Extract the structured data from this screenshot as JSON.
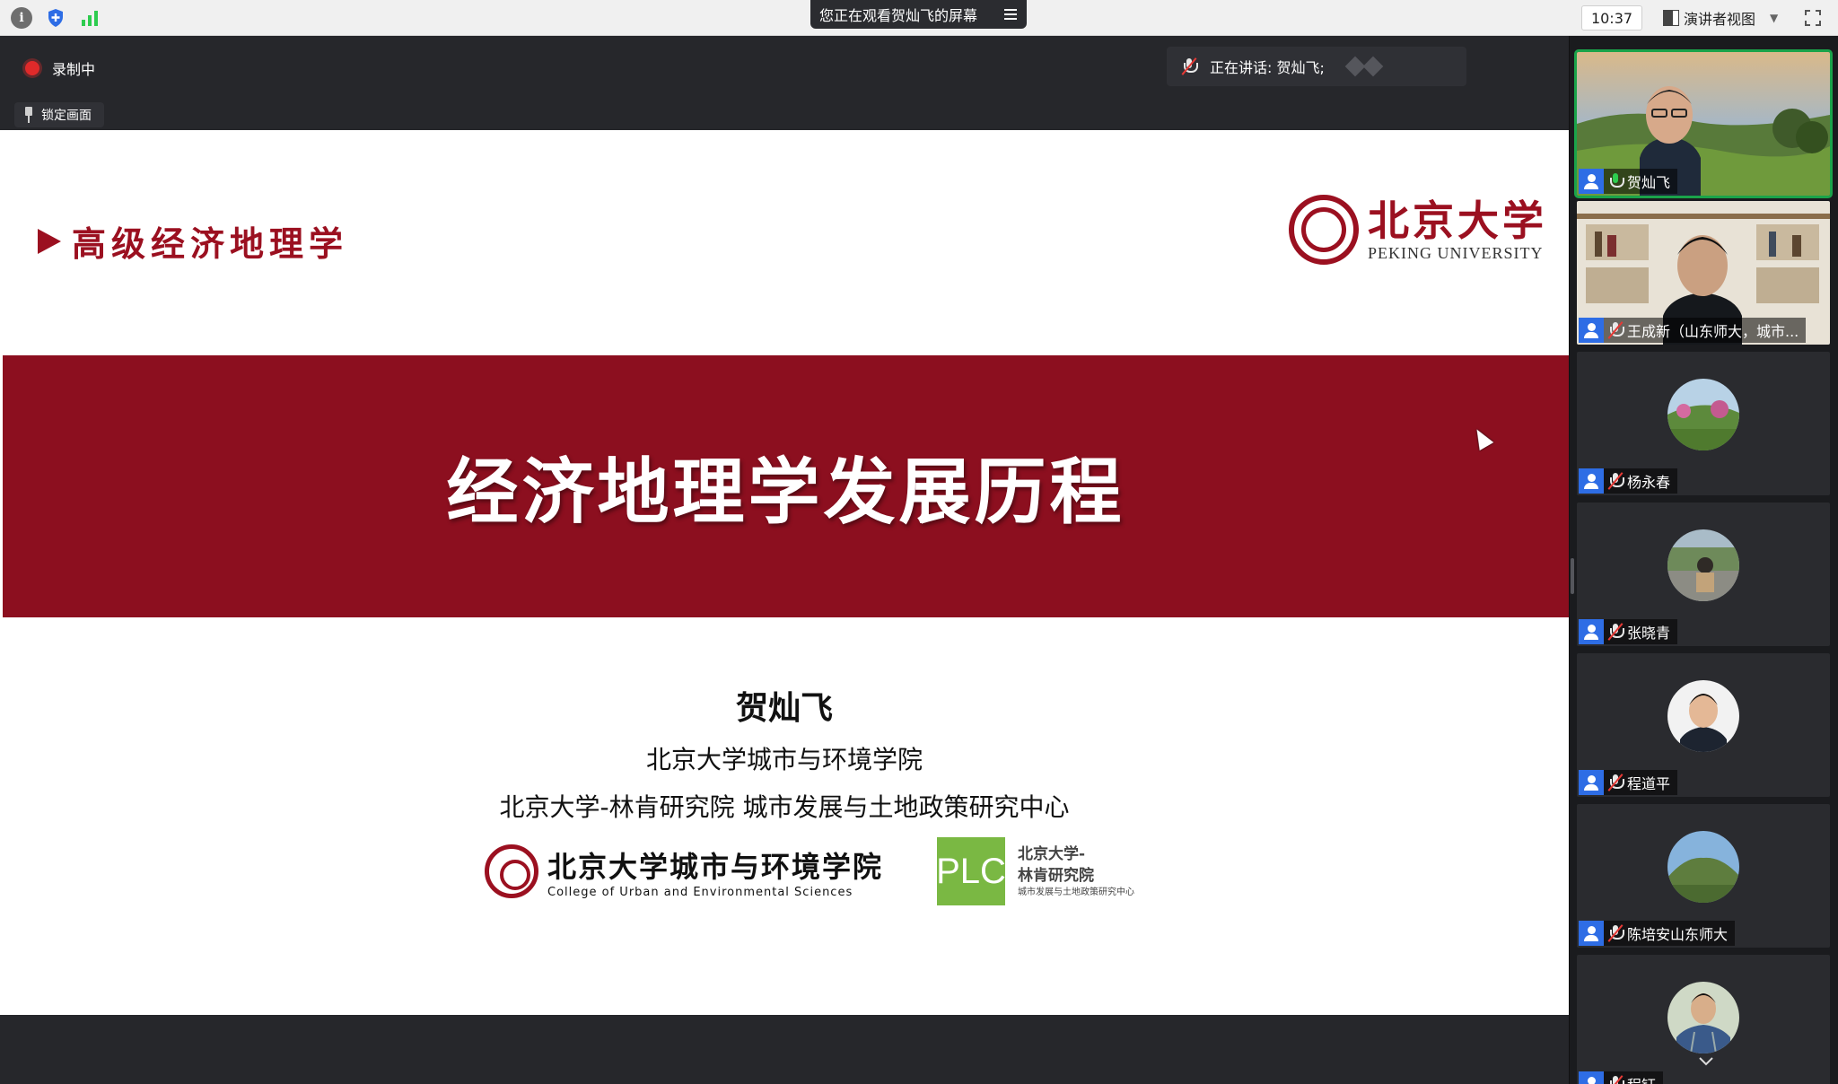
{
  "topbar": {
    "viewing_notice": "您正在观看贺灿飞的屏幕",
    "time": "10:37",
    "view_mode": "演讲者视图"
  },
  "stage": {
    "recording_label": "录制中",
    "lock_label": "锁定画面",
    "speaking_label": "正在讲话: 贺灿飞;"
  },
  "slide": {
    "course_title": "高级经济地理学",
    "pku_cn": "北京大学",
    "pku_en": "PEKING UNIVERSITY",
    "main_title": "经济地理学发展历程",
    "presenter_name": "贺灿飞",
    "affiliation_1": "北京大学城市与环境学院",
    "affiliation_2": "北京大学-林肯研究院 城市发展与土地政策研究中心",
    "college_cn": "北京大学城市与环境学院",
    "college_en": "College of Urban and Environmental Sciences",
    "plc_mark": "PLC",
    "plc_line1": "北京大学-",
    "plc_line2": "林肯研究院",
    "plc_line3": "城市发展与土地政策研究中心"
  },
  "participants": [
    {
      "name": "贺灿飞",
      "speaking": true
    },
    {
      "name": "王成新（山东师大，城市...",
      "speaking": false
    },
    {
      "name": "杨永春",
      "speaking": false
    },
    {
      "name": "张晓青",
      "speaking": false
    },
    {
      "name": "程道平",
      "speaking": false
    },
    {
      "name": "陈培安山东师大",
      "speaking": false
    },
    {
      "name": "程钰",
      "speaking": false
    }
  ],
  "colors": {
    "slide_accent": "#8c0f1f",
    "plc_green": "#7ab843",
    "user_badge": "#2e6de5",
    "active_border": "#1aa34a"
  }
}
